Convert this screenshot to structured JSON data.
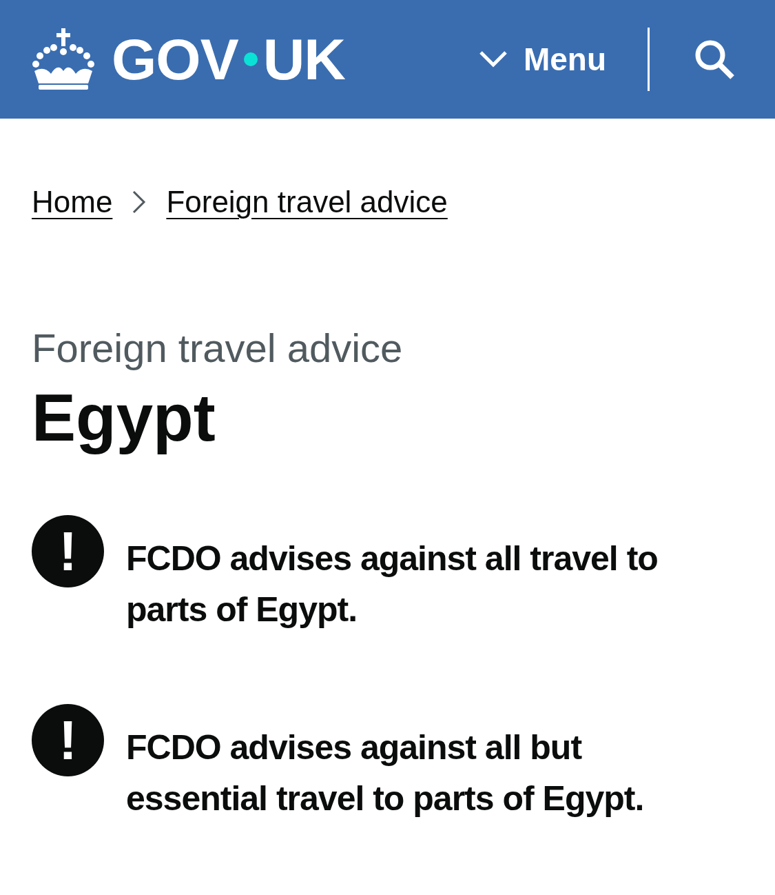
{
  "header": {
    "logo": {
      "left": "GOV",
      "right": "UK"
    },
    "menu": {
      "label": "Menu",
      "expanded": false
    }
  },
  "breadcrumbs": [
    {
      "label": "Home"
    },
    {
      "label": "Foreign travel advice"
    }
  ],
  "caption": "Foreign travel advice",
  "title": "Egypt",
  "warnings": [
    {
      "icon": "!",
      "text": "FCDO advises against all travel to parts of Egypt."
    },
    {
      "icon": "!",
      "text": "FCDO advises against all but essential travel to parts of Egypt."
    }
  ]
}
